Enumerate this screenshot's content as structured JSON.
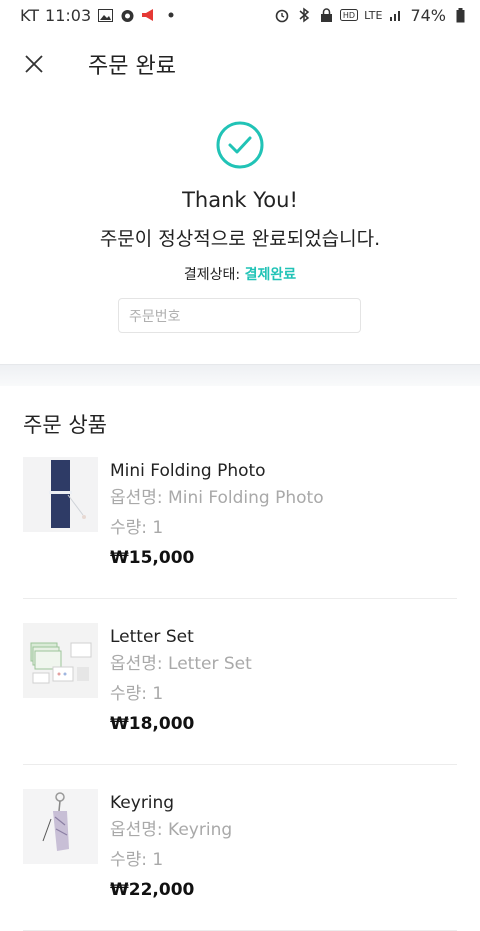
{
  "status_bar": {
    "carrier": "KT",
    "time": "11:03",
    "network": "LTE",
    "battery": "74%"
  },
  "header": {
    "title": "주문 완료"
  },
  "confirmation": {
    "thanks": "Thank You!",
    "message": "주문이 정상적으로 완료되었습니다.",
    "payment_label": "결제상태:",
    "payment_status": "결제완료",
    "order_number_label": "주문번호",
    "accent_color": "#21c3b6"
  },
  "products_section": {
    "title": "주문 상품",
    "items": [
      {
        "name": "Mini Folding Photo",
        "option": "옵션명: Mini Folding Photo",
        "qty": "수량: 1",
        "price": "₩15,000"
      },
      {
        "name": "Letter Set",
        "option": "옵션명: Letter Set",
        "qty": "수량: 1",
        "price": "₩18,000"
      },
      {
        "name": "Keyring",
        "option": "옵션명: Keyring",
        "qty": "수량: 1",
        "price": "₩22,000"
      }
    ]
  }
}
